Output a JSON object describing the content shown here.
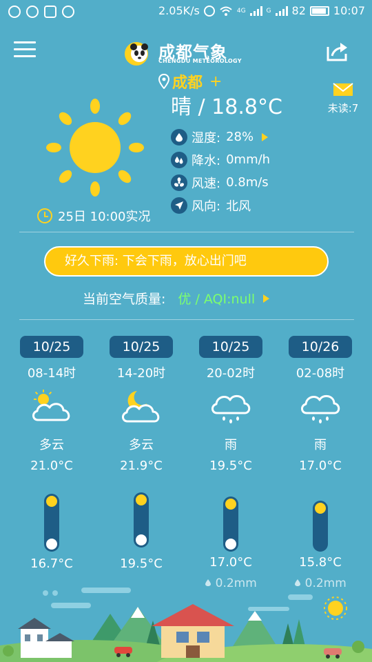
{
  "status_bar": {
    "speed": "2.05K/s",
    "net_a": "4G",
    "net_b": "G",
    "battery": "82",
    "time": "10:07"
  },
  "header": {
    "title": "成都气象",
    "subtitle": "CHENGDU METEOROLOGY"
  },
  "current": {
    "city": "成都",
    "add_symbol": "+",
    "condition_temp": "晴 / 18.8°C",
    "unread": "未读:7",
    "humidity": {
      "label": "湿度:",
      "value": "28%"
    },
    "rain": {
      "label": "降水:",
      "value": "0mm/h"
    },
    "wind_speed": {
      "label": "风速:",
      "value": "0.8m/s"
    },
    "wind_dir": {
      "label": "风向:",
      "value": "北风"
    },
    "observed": "25日 10:00实况"
  },
  "tip": "好久下雨: 下会下雨，放心出门吧",
  "air": {
    "label": "当前空气质量:",
    "value": "优 / AQI:null"
  },
  "forecast": [
    {
      "date": "10/25",
      "period": "08-14时",
      "icon": "partly-cloudy-day-icon",
      "cond": "多云",
      "high": "21.0°C",
      "low": "16.7°C",
      "precip": ""
    },
    {
      "date": "10/25",
      "period": "14-20时",
      "icon": "partly-cloudy-night-icon",
      "cond": "多云",
      "high": "21.9°C",
      "low": "19.5°C",
      "precip": ""
    },
    {
      "date": "10/25",
      "period": "20-02时",
      "icon": "rain-icon",
      "cond": "雨",
      "high": "19.5°C",
      "low": "17.0°C",
      "precip": "0.2mm"
    },
    {
      "date": "10/26",
      "period": "02-08时",
      "icon": "rain-icon",
      "cond": "雨",
      "high": "17.0°C",
      "low": "15.8°C",
      "precip": "0.2mm"
    }
  ],
  "colors": {
    "background": "#52aec9",
    "accent_yellow": "#ffd21f",
    "dark_blue": "#1e5d86",
    "aqi_good": "#7dff6e"
  }
}
